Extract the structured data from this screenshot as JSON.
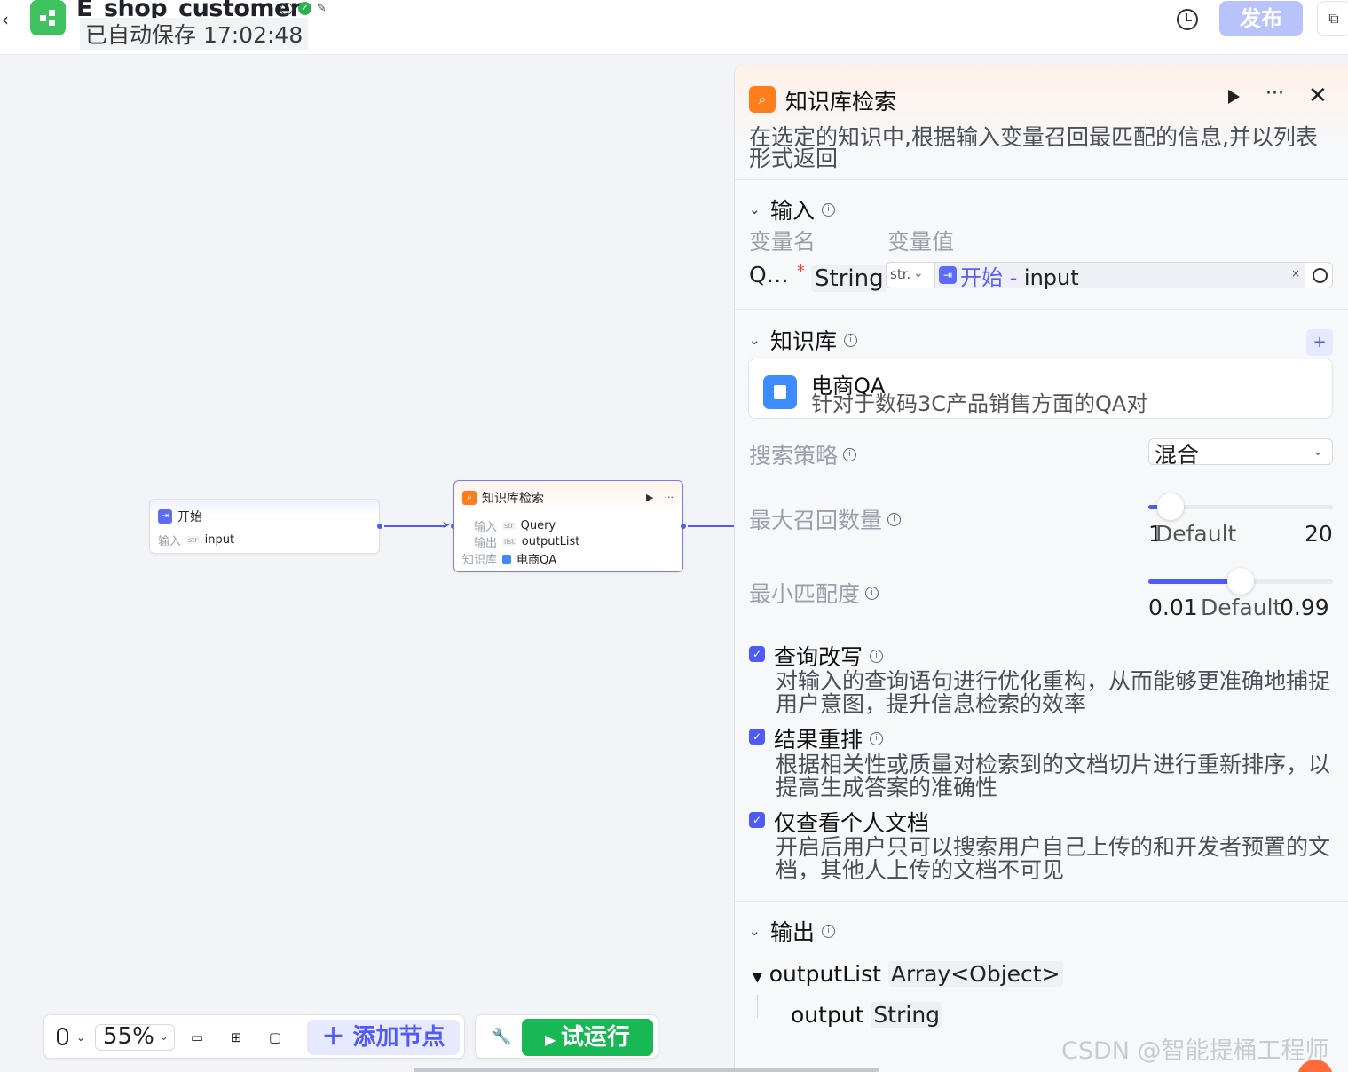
{
  "header": {
    "app_title": "E_shop_customer",
    "autosave": "已自动保存 17:02:48",
    "publish": "发布"
  },
  "canvas": {
    "start_node": {
      "title": "开始",
      "input_label": "输入",
      "input_tag": "str",
      "input_value": "input"
    },
    "kb_node": {
      "title": "知识库检索",
      "input_label": "输入",
      "input_tag": "str",
      "input_value": "Query",
      "output_label": "输出",
      "output_tag": "list",
      "output_value": "outputList",
      "kb_label": "知识库",
      "kb_value": "电商QA"
    }
  },
  "panel": {
    "title": "知识库检索",
    "description": "在选定的知识中,根据输入变量召回最匹配的信息,并以列表形式返回",
    "input_section": {
      "title": "输入",
      "col_name": "变量名",
      "col_value": "变量值",
      "var_name": "Q…",
      "required_mark": "*",
      "var_type": "String",
      "type_tag": "str.",
      "ref_source": "开始",
      "ref_sep": " - ",
      "ref_var": "input",
      "clear": "×"
    },
    "kb_section": {
      "title": "知识库",
      "add": "+",
      "kb_name": "电商QA",
      "kb_desc": "针对于数码3C产品销售方面的QA对"
    },
    "strategy": {
      "label": "搜索策略",
      "value": "混合"
    },
    "max_recall": {
      "label": "最大召回数量",
      "min": "1",
      "default_label": "Default",
      "max": "20",
      "level": 0.12
    },
    "min_score": {
      "label": "最小匹配度",
      "min": "0.01",
      "default_label": "Default",
      "max": "0.99",
      "level": 0.5
    },
    "options": [
      {
        "title": "查询改写",
        "desc": "对输入的查询语句进行优化重构，从而能够更准确地捕捉用户意图，提升信息检索的效率",
        "checked": true
      },
      {
        "title": "结果重排",
        "desc": "根据相关性或质量对检索到的文档切片进行重新排序，以提高生成答案的准确性",
        "checked": true
      },
      {
        "title": "仅查看个人文档",
        "desc": "开启后用户只可以搜索用户自己上传的和开发者预置的文档，其他人上传的文档不可见",
        "checked": true
      }
    ],
    "output_section": {
      "title": "输出",
      "out1_name": "outputList",
      "out1_type": "Array<Object>",
      "out2_name": "output",
      "out2_type": "String"
    }
  },
  "toolbar": {
    "zoom": "55%",
    "add_node": "添加节点",
    "trial_run": "试运行"
  },
  "watermark": "CSDN @智能提桶工程师",
  "colors": {
    "accent": "#4e5bf5",
    "green": "#18b954",
    "orange": "#ff7d1a"
  }
}
